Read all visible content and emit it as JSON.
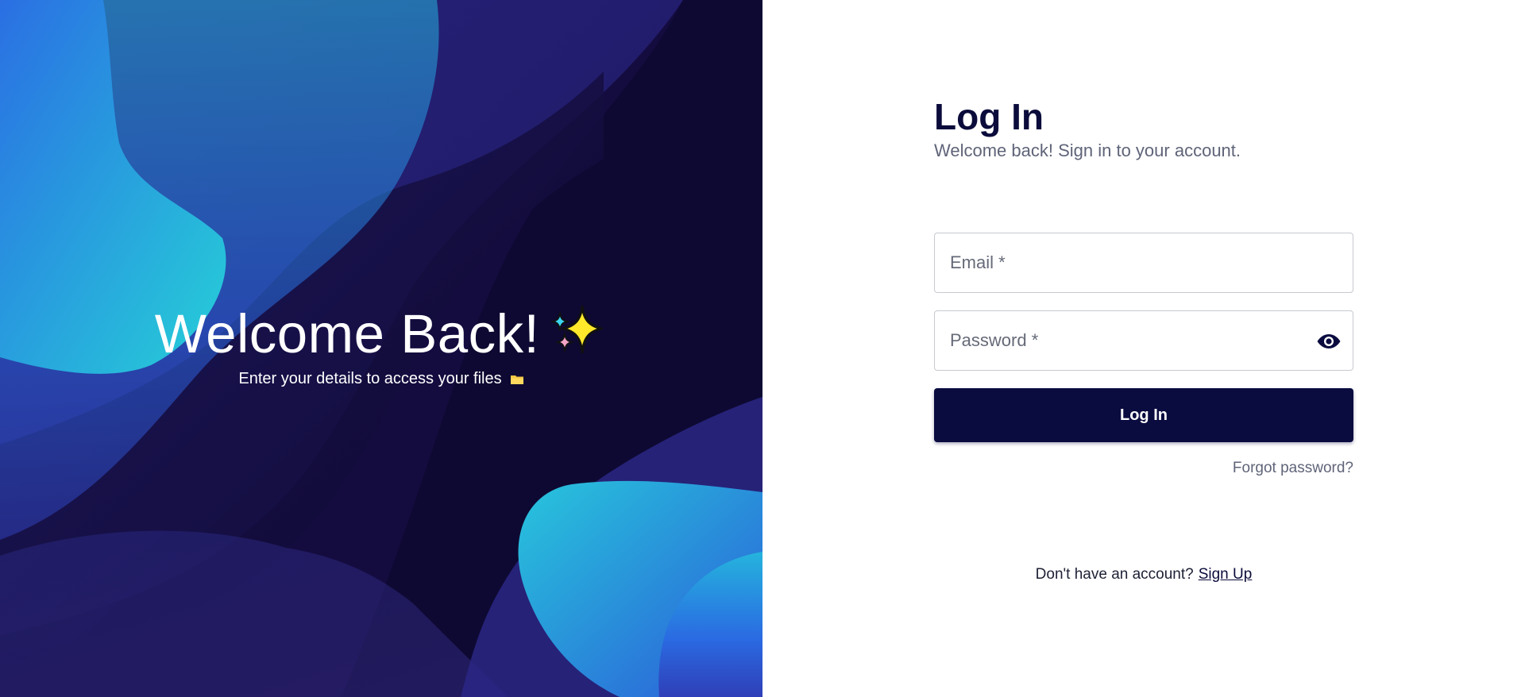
{
  "hero": {
    "title": "Welcome Back!",
    "title_icon": "sparkles-icon",
    "subtitle": "Enter your details to access your files",
    "subtitle_icon": "folder-icon",
    "colors": {
      "background_dark": "#120a3a",
      "wave_purple": "#2a2a8f",
      "wave_blue": "#2e6fe0",
      "wave_cyan": "#2cd3d9"
    }
  },
  "login": {
    "title": "Log In",
    "subtitle": "Welcome back! Sign in to your account.",
    "email_placeholder": "Email *",
    "password_placeholder": "Password *",
    "password_toggle_icon": "eye-icon",
    "submit_label": "Log In",
    "forgot_password": "Forgot password?",
    "signup_prompt": "Don't have an account?",
    "signup_link": "Sign Up",
    "colors": {
      "primary": "#0a0b3f",
      "muted_text": "#5f6478",
      "border": "#c7c9cf"
    }
  }
}
